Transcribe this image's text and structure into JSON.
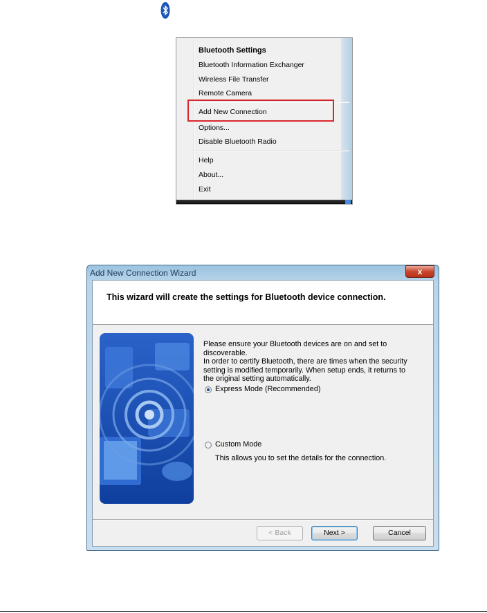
{
  "tray": {
    "icon": "bluetooth-icon"
  },
  "context_menu": {
    "items": [
      {
        "label": "Bluetooth Settings",
        "bold": true
      },
      {
        "label": "Bluetooth Information Exchanger"
      },
      {
        "label": "Wireless File Transfer"
      },
      {
        "label": "Remote Camera"
      },
      {
        "label": "Add New Connection",
        "highlighted": true
      },
      {
        "label": "Options..."
      },
      {
        "label": "Disable Bluetooth Radio"
      },
      {
        "label": "Help"
      },
      {
        "label": "About..."
      },
      {
        "label": "Exit"
      }
    ],
    "highlight_color": "#d9262c"
  },
  "wizard": {
    "title": "Add New Connection Wizard",
    "close_label": "x",
    "header": "This wizard will create the settings for Bluetooth device connection.",
    "intro_line1": "Please ensure your Bluetooth devices are on and set to discoverable.",
    "intro_line2": "In order to certify Bluetooth, there are times when the security setting is modified temporarily. When setup ends, it returns to the original setting automatically.",
    "options": {
      "express": {
        "label": "Express Mode (Recommended)",
        "checked": true
      },
      "custom": {
        "label": "Custom Mode",
        "checked": false,
        "description": "This allows you to set the details for the connection."
      }
    },
    "buttons": {
      "back": "< Back",
      "next": "Next >",
      "cancel": "Cancel"
    }
  }
}
